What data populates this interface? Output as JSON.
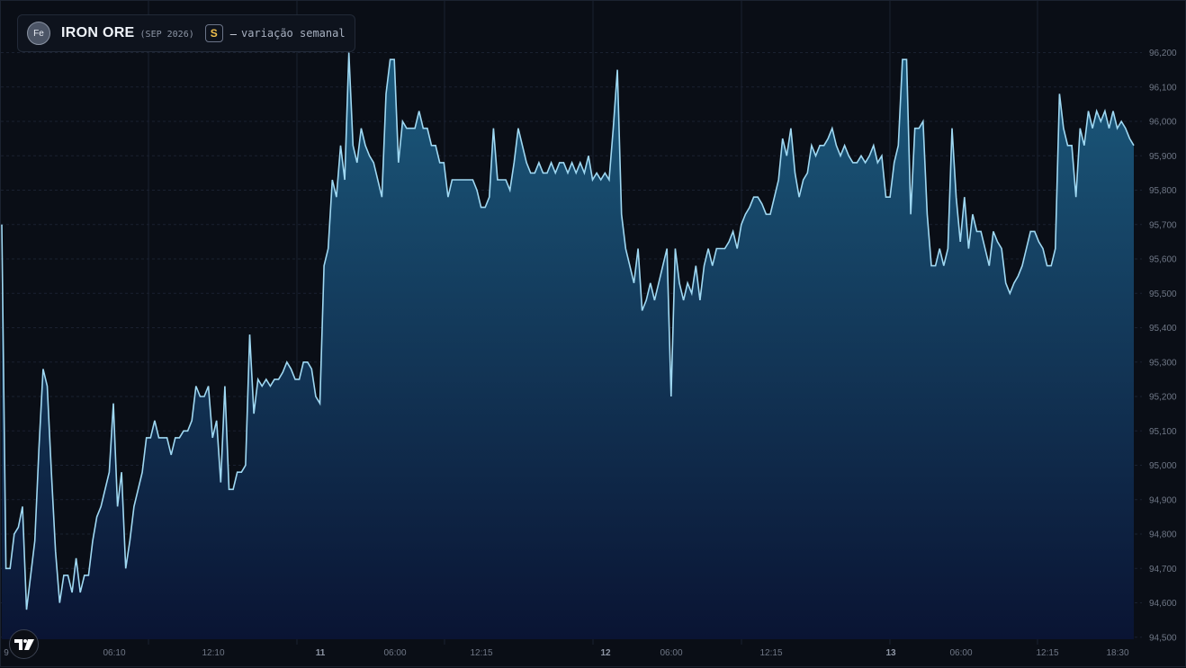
{
  "legend": {
    "avatar_text": "Fe",
    "title": "IRON ORE",
    "contract": "(SEP 2026)",
    "badge": "S",
    "dash": "–",
    "description": "variação semanal"
  },
  "colors": {
    "background": "#0a0e16",
    "line": "#9fd8f2",
    "area_top": "#1b5a7d",
    "area_bottom": "#0a1433",
    "grid": "#1a2130",
    "axis_text": "#6f7786",
    "badge_accent": "#f2c14e"
  },
  "chart_data": {
    "type": "area",
    "title": "IRON ORE (SEP 2026)",
    "subtitle": "variação semanal",
    "grid": true,
    "y_axis_position": "right",
    "ylim": [
      94500,
      96200
    ],
    "y_ticks": [
      {
        "value": 96200,
        "label": "96,200"
      },
      {
        "value": 96100,
        "label": "96,100"
      },
      {
        "value": 96000,
        "label": "96,000"
      },
      {
        "value": 95900,
        "label": "95,900"
      },
      {
        "value": 95800,
        "label": "95,800"
      },
      {
        "value": 95700,
        "label": "95,700"
      },
      {
        "value": 95600,
        "label": "95,600"
      },
      {
        "value": 95500,
        "label": "95,500"
      },
      {
        "value": 95400,
        "label": "95,400"
      },
      {
        "value": 95300,
        "label": "95,300"
      },
      {
        "value": 95200,
        "label": "95,200"
      },
      {
        "value": 95100,
        "label": "95,100"
      },
      {
        "value": 95000,
        "label": "95,000"
      },
      {
        "value": 94900,
        "label": "94,900"
      },
      {
        "value": 94800,
        "label": "94,800"
      },
      {
        "value": 94700,
        "label": "94,700"
      },
      {
        "value": 94600,
        "label": "94,600"
      },
      {
        "value": 94500,
        "label": "94,500"
      }
    ],
    "x_ticks": [
      {
        "label": "9",
        "bold": false
      },
      {
        "label": "06:10",
        "bold": false
      },
      {
        "label": "12:10",
        "bold": false
      },
      {
        "label": "11",
        "bold": true
      },
      {
        "label": "06:00",
        "bold": false
      },
      {
        "label": "12:15",
        "bold": false
      },
      {
        "label": "12",
        "bold": true
      },
      {
        "label": "06:00",
        "bold": false
      },
      {
        "label": "12:15",
        "bold": false
      },
      {
        "label": "13",
        "bold": true
      },
      {
        "label": "06:00",
        "bold": false
      },
      {
        "label": "12:15",
        "bold": false
      },
      {
        "label": "18:30",
        "bold": false
      }
    ],
    "values": [
      95700,
      94700,
      94700,
      94800,
      94820,
      94880,
      94580,
      94680,
      94780,
      95050,
      95280,
      95230,
      94980,
      94750,
      94600,
      94680,
      94680,
      94630,
      94730,
      94630,
      94680,
      94680,
      94780,
      94850,
      94880,
      94930,
      94980,
      95180,
      94880,
      94980,
      94700,
      94780,
      94880,
      94930,
      94980,
      95080,
      95080,
      95130,
      95080,
      95080,
      95080,
      95030,
      95080,
      95080,
      95100,
      95100,
      95130,
      95230,
      95200,
      95200,
      95230,
      95080,
      95130,
      94950,
      95230,
      94930,
      94930,
      94980,
      94980,
      95000,
      95380,
      95150,
      95250,
      95230,
      95250,
      95230,
      95250,
      95250,
      95270,
      95300,
      95280,
      95250,
      95250,
      95300,
      95300,
      95280,
      95200,
      95180,
      95580,
      95630,
      95830,
      95780,
      95930,
      95830,
      96200,
      95930,
      95880,
      95980,
      95930,
      95900,
      95880,
      95830,
      95780,
      96080,
      96180,
      96180,
      95880,
      96000,
      95980,
      95980,
      95980,
      96030,
      95980,
      95980,
      95930,
      95930,
      95880,
      95880,
      95780,
      95830,
      95830,
      95830,
      95830,
      95830,
      95830,
      95800,
      95750,
      95750,
      95780,
      95980,
      95830,
      95830,
      95830,
      95800,
      95880,
      95980,
      95930,
      95880,
      95850,
      95850,
      95880,
      95850,
      95850,
      95880,
      95850,
      95880,
      95880,
      95850,
      95880,
      95850,
      95880,
      95850,
      95900,
      95830,
      95850,
      95830,
      95850,
      95830,
      95980,
      96150,
      95730,
      95630,
      95580,
      95530,
      95630,
      95450,
      95480,
      95530,
      95480,
      95530,
      95580,
      95630,
      95200,
      95630,
      95530,
      95480,
      95530,
      95500,
      95580,
      95480,
      95580,
      95630,
      95580,
      95630,
      95630,
      95630,
      95650,
      95680,
      95630,
      95700,
      95730,
      95750,
      95780,
      95780,
      95760,
      95730,
      95730,
      95780,
      95830,
      95950,
      95900,
      95980,
      95850,
      95780,
      95830,
      95850,
      95930,
      95900,
      95930,
      95930,
      95950,
      95980,
      95930,
      95900,
      95930,
      95900,
      95880,
      95880,
      95900,
      95880,
      95900,
      95930,
      95880,
      95900,
      95780,
      95780,
      95880,
      95930,
      96180,
      96180,
      95730,
      95980,
      95980,
      96000,
      95730,
      95580,
      95580,
      95630,
      95580,
      95630,
      95980,
      95780,
      95650,
      95780,
      95630,
      95730,
      95680,
      95680,
      95630,
      95580,
      95680,
      95650,
      95630,
      95530,
      95500,
      95530,
      95550,
      95580,
      95630,
      95680,
      95680,
      95650,
      95630,
      95580,
      95580,
      95630,
      96080,
      95980,
      95930,
      95930,
      95780,
      95980,
      95930,
      96030,
      95980,
      96030,
      96000,
      96030,
      95980,
      96030,
      95980,
      96000,
      95980,
      95950,
      95930
    ],
    "xlabel": "",
    "ylabel": ""
  }
}
